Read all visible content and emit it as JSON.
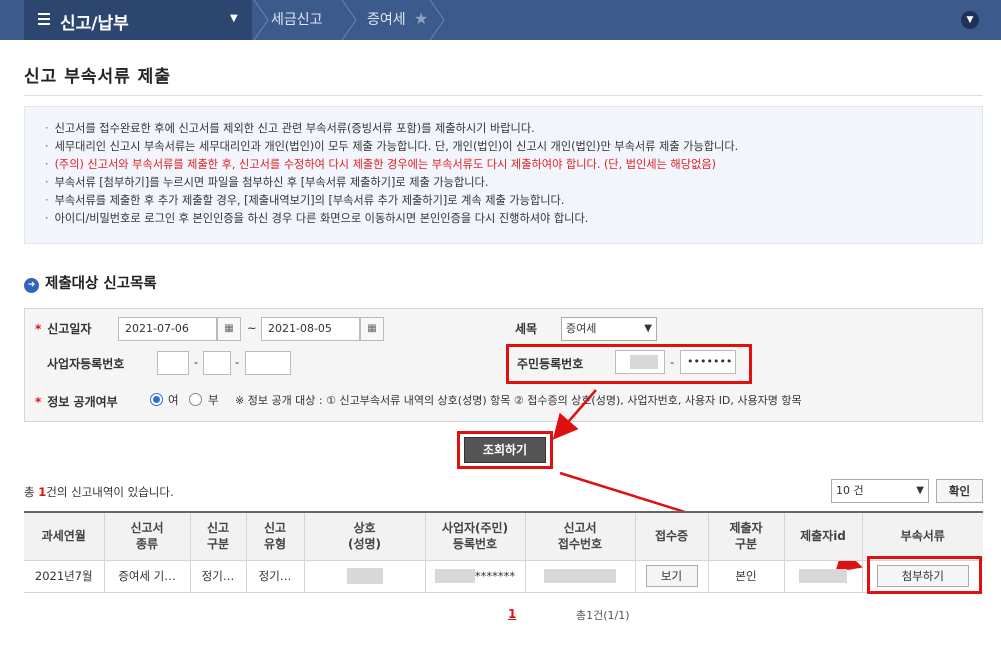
{
  "nav": {
    "menu_title": "신고/납부",
    "crumb1": "세금신고",
    "crumb2": "증여세"
  },
  "page": {
    "title": "신고 부속서류 제출"
  },
  "notice": {
    "line1": "신고서를 접수완료한 후에 신고서를 제외한 신고 관련 부속서류(증빙서류 포함)를 제출하시기 바랍니다.",
    "line2": "세무대리인 신고시 부속서류는 세무대리인과 개인(법인)이 모두 제출 가능합니다. 단, 개인(법인)이 신고시 개인(법인)만 부속서류 제출 가능합니다.",
    "line3": "(주의) 신고서와 부속서류를 제출한 후, 신고서를 수정하여 다시 제출한 경우에는 부속서류도 다시 제출하여야 합니다. (단, 법인세는 해당없음)",
    "line4": "부속서류 [첨부하기]를 누르시면 파일을 첨부하신 후 [부속서류 제출하기]로 제출 가능합니다.",
    "line5": "부속서류를 제출한 후 추가 제출할 경우, [제출내역보기]의 [부속서류 추가 제출하기]로 계속 제출 가능합니다.",
    "line6": "아이디/비밀번호로 로그인 후 본인인증을 하신 경우 다른 화면으로 이동하시면 본인인증을 다시 진행하셔야 합니다."
  },
  "section": {
    "title": "제출대상 신고목록"
  },
  "form": {
    "date_label": "신고일자",
    "date_from": "2021-07-06",
    "date_tilde": "~",
    "date_to": "2021-08-05",
    "tax_label": "세목",
    "tax_value": "증여세",
    "bizno_label": "사업자등록번호",
    "dash": "-",
    "rrn_label": "주민등록번호",
    "rrn_back": "•••••••",
    "disclose_label": "정보 공개여부",
    "yes": "여",
    "no": "부",
    "disclose_note": "※ 정보 공개 대상 : ① 신고부속서류 내역의 상호(성명) 항목 ② 접수증의 상호(성명), 사업자번호, 사용자 ID, 사용자명 항목",
    "search_button": "조회하기"
  },
  "result": {
    "total_prefix": "총 ",
    "total_count": "1",
    "total_suffix": "건의 신고내역이 있습니다.",
    "page_size": "10 건",
    "confirm": "확인",
    "headers": {
      "h1": "과세연월",
      "h2a": "신고서",
      "h2b": "종류",
      "h3a": "신고",
      "h3b": "구분",
      "h4a": "신고",
      "h4b": "유형",
      "h5a": "상호",
      "h5b": "(성명)",
      "h6a": "사업자(주민)",
      "h6b": "등록번호",
      "h7a": "신고서",
      "h7b": "접수번호",
      "h8": "접수증",
      "h9a": "제출자",
      "h9b": "구분",
      "h10": "제출자id",
      "h11": "부속서류"
    },
    "row": {
      "period": "2021년7월",
      "kind": "증여세 기…",
      "type": "정기…",
      "form": "정기…",
      "regno_tail": "*******",
      "receipt_button": "보기",
      "submitter": "본인",
      "attach_button": "첨부하기"
    }
  },
  "pager": {
    "current": "1",
    "summary": "총1건(1/1)"
  }
}
